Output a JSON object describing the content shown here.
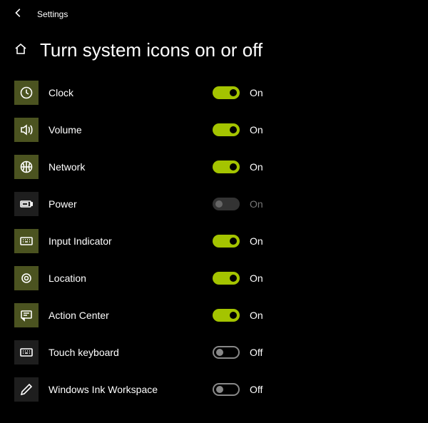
{
  "header": {
    "settings_label": "Settings"
  },
  "page": {
    "title": "Turn system icons on or off"
  },
  "state_labels": {
    "on": "On",
    "off": "Off"
  },
  "colors": {
    "accent": "#a4c400",
    "icon_bg_on": "#4b5320"
  },
  "items": [
    {
      "id": "clock",
      "label": "Clock",
      "state": "on",
      "icon": "clock-icon"
    },
    {
      "id": "volume",
      "label": "Volume",
      "state": "on",
      "icon": "volume-icon"
    },
    {
      "id": "network",
      "label": "Network",
      "state": "on",
      "icon": "globe-icon"
    },
    {
      "id": "power",
      "label": "Power",
      "state": "disabled",
      "state_text": "On",
      "icon": "battery-icon"
    },
    {
      "id": "input-indicator",
      "label": "Input Indicator",
      "state": "on",
      "icon": "keyboard-icon"
    },
    {
      "id": "location",
      "label": "Location",
      "state": "on",
      "icon": "location-icon"
    },
    {
      "id": "action-center",
      "label": "Action Center",
      "state": "on",
      "icon": "action-center-icon"
    },
    {
      "id": "touch-keyboard",
      "label": "Touch keyboard",
      "state": "off",
      "icon": "keyboard-icon"
    },
    {
      "id": "windows-ink-workspace",
      "label": "Windows Ink Workspace",
      "state": "off",
      "icon": "pen-icon"
    }
  ]
}
